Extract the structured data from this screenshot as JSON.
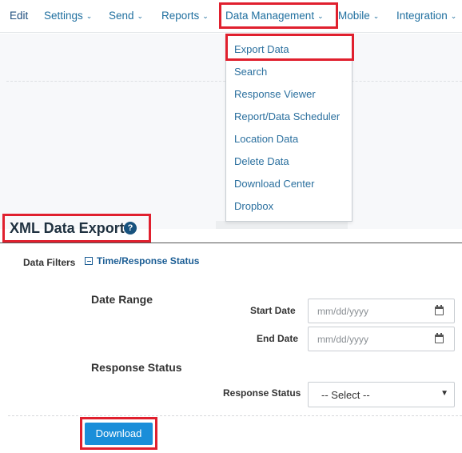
{
  "nav": {
    "items": [
      {
        "label": "Edit"
      },
      {
        "label": "Settings"
      },
      {
        "label": "Send"
      },
      {
        "label": "Reports"
      },
      {
        "label": "Data Management"
      },
      {
        "label": "Mobile"
      },
      {
        "label": "Integration"
      }
    ],
    "chevron": "⌄"
  },
  "dropdown": {
    "items": [
      {
        "label": "Export Data"
      },
      {
        "label": "Search"
      },
      {
        "label": "Response Viewer"
      },
      {
        "label": "Report/Data Scheduler"
      },
      {
        "label": "Location Data"
      },
      {
        "label": "Delete Data"
      },
      {
        "label": "Download Center"
      },
      {
        "label": "Dropbox"
      }
    ]
  },
  "page": {
    "title": "XML Data Export",
    "help_icon": "?"
  },
  "filters": {
    "label": "Data Filters",
    "toggle_label": "Time/Response Status",
    "date_range": {
      "heading": "Date Range",
      "start_label": "Start Date",
      "start_placeholder": "mm/dd/yyyy",
      "end_label": "End Date",
      "end_placeholder": "mm/dd/yyyy"
    },
    "response_status": {
      "heading": "Response Status",
      "label": "Response Status",
      "selected": "-- Select --"
    }
  },
  "actions": {
    "download_label": "Download"
  },
  "icons": {
    "help": "help-icon",
    "calendar": "calendar-icon",
    "collapse": "minus-square-icon",
    "caret": "caret-down-icon"
  },
  "colors": {
    "highlight": "#e0202e",
    "link": "#1f6f9f",
    "button": "#1a8ed9"
  }
}
